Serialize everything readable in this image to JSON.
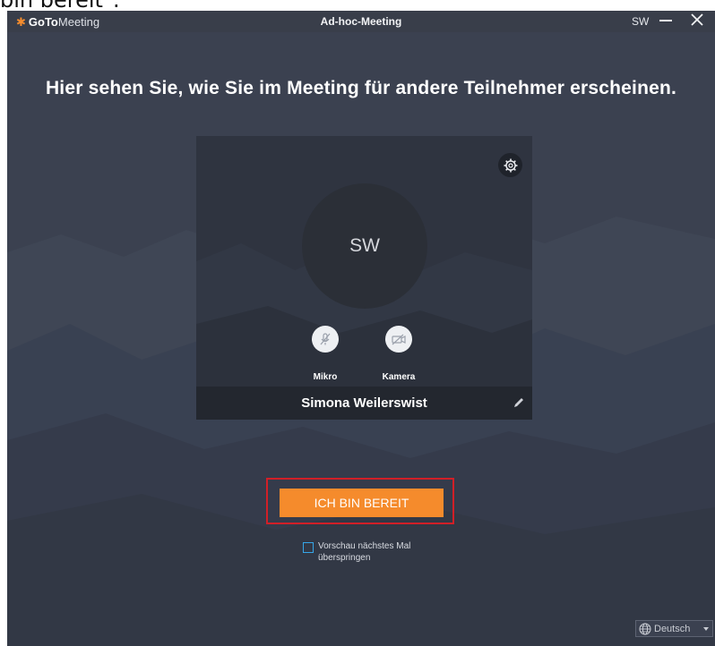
{
  "caption": {
    "text": "bin bereit\"."
  },
  "titlebar": {
    "logo_goto": "GoTo",
    "logo_meeting": "Meeting",
    "title": "Ad-hoc-Meeting",
    "initials": "SW",
    "minimize_icon": "minimize-icon",
    "close_icon": "close-icon"
  },
  "main": {
    "headline": "Hier sehen Sie, wie Sie im Meeting für andere Teilnehmer erscheinen."
  },
  "preview": {
    "avatar_initials": "SW",
    "mic_label": "Mikro",
    "camera_label": "Kamera",
    "name": "Simona Weilerswist",
    "icons": [
      "gear-icon",
      "mic-muted-icon",
      "camera-off-icon",
      "pencil-icon"
    ]
  },
  "actions": {
    "ready_label": "ICH BIN BEREIT",
    "skip_label": "Vorschau nächstes Mal überspringen",
    "skip_checked": false
  },
  "language": {
    "selected": "Deutsch",
    "icon": "globe-icon"
  },
  "colors": {
    "background": "#3b4150",
    "accent": "#f58b2c",
    "highlight_border": "#d11f27",
    "checkbox": "#36a6e8"
  }
}
